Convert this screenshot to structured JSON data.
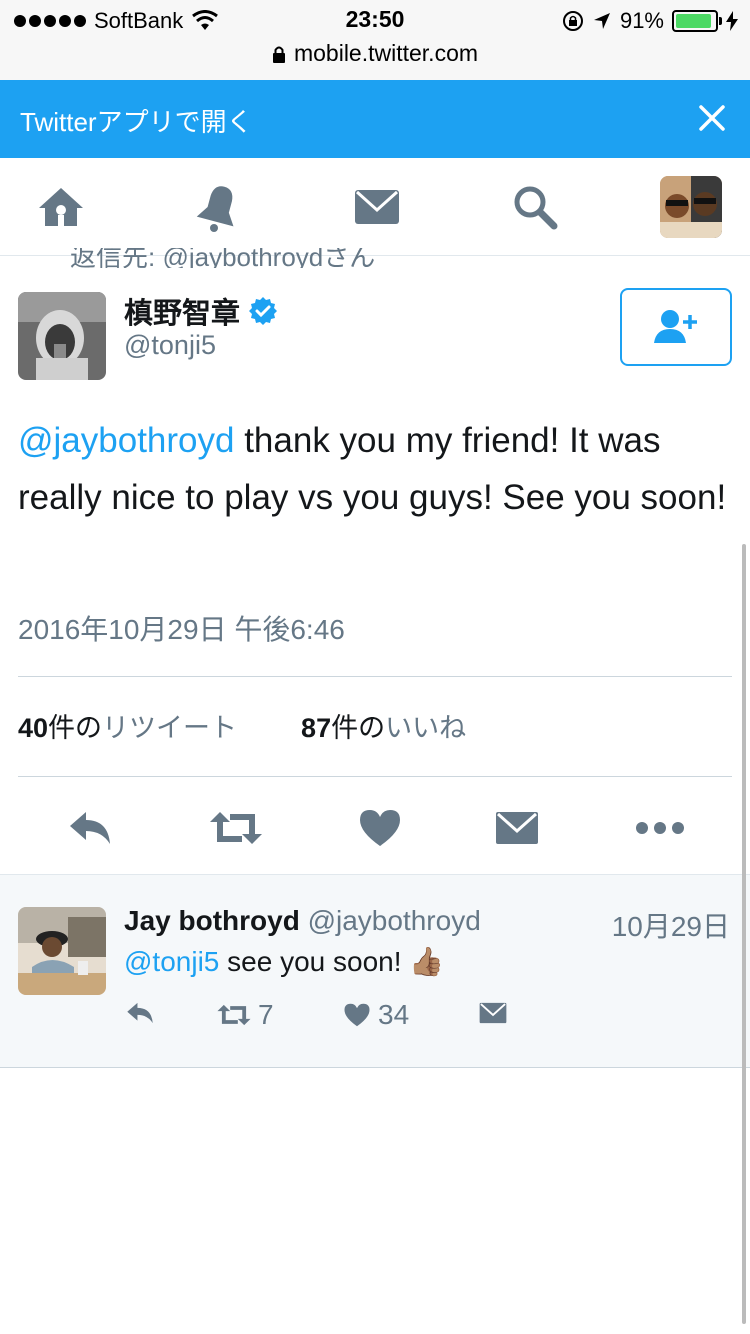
{
  "status_bar": {
    "carrier": "SoftBank",
    "time": "23:50",
    "battery_percent": "91%",
    "battery_level": 0.91
  },
  "url_bar": {
    "domain": "mobile.twitter.com"
  },
  "banner": {
    "text": "Twitterアプリで開く",
    "close_icon": "close-icon"
  },
  "nav": {
    "items": [
      "home-icon",
      "notifications-icon",
      "messages-icon",
      "search-icon",
      "profile-avatar"
    ]
  },
  "tweet": {
    "reply_context": "返信先: @jaybothroydさん",
    "author_name": "槙野智章",
    "author_handle": "@tonji5",
    "text_mention": "@jaybothroyd",
    "text_body": " thank you my friend! It was really nice to play vs you guys! See you soon!",
    "timestamp": "2016年10月29日 午後6:46",
    "retweet_count": "40",
    "retweet_unit": "件の",
    "retweet_label": "リツイート",
    "like_count": "87",
    "like_unit": "件の",
    "like_label": "いいね",
    "colors": {
      "accent": "#1da1f2",
      "muted": "#657786"
    }
  },
  "reply": {
    "name": "Jay bothroyd",
    "handle": "@jaybothroyd",
    "date": "10月29日",
    "mention": "@tonji5",
    "text": " see you soon! 👍🏽",
    "retweets": "7",
    "likes": "34"
  }
}
